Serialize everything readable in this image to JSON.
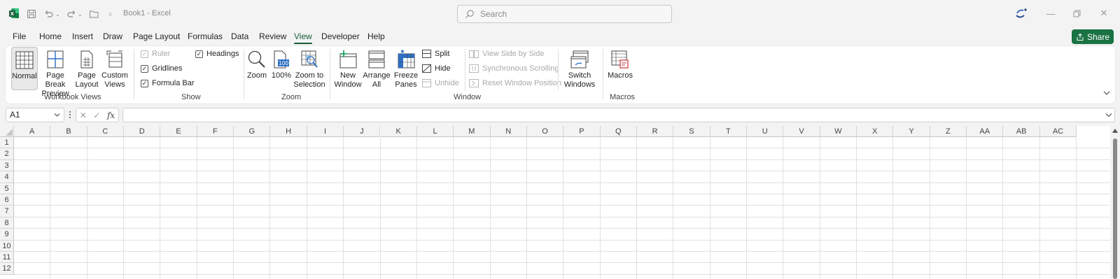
{
  "app": {
    "title": "Book1 - Excel",
    "accent": "#185c37",
    "share_color": "#1a7343"
  },
  "search": {
    "placeholder": "Search"
  },
  "menu": {
    "tabs": [
      "File",
      "Home",
      "Insert",
      "Draw",
      "Page Layout",
      "Formulas",
      "Data",
      "Review",
      "View",
      "Developer",
      "Help"
    ],
    "active": "View"
  },
  "share": {
    "label": "Share"
  },
  "ribbon": {
    "workbook_views": {
      "label": "Workbook Views",
      "normal": "Normal",
      "page_break_1": "Page Break",
      "page_break_2": "Preview",
      "page_layout_1": "Page",
      "page_layout_2": "Layout",
      "custom_1": "Custom",
      "custom_2": "Views"
    },
    "show": {
      "label": "Show",
      "ruler": "Ruler",
      "gridlines": "Gridlines",
      "formula_bar": "Formula Bar",
      "headings": "Headings"
    },
    "zoom": {
      "label": "Zoom",
      "zoom": "Zoom",
      "hundred": "100%",
      "hundred_icon": "100",
      "zoom_sel_1": "Zoom to",
      "zoom_sel_2": "Selection"
    },
    "window": {
      "label": "Window",
      "new_1": "New",
      "new_2": "Window",
      "arrange_1": "Arrange",
      "arrange_2": "All",
      "freeze_1": "Freeze",
      "freeze_2": "Panes",
      "split": "Split",
      "hide": "Hide",
      "unhide": "Unhide",
      "side_by_side": "View Side by Side",
      "sync_scroll": "Synchronous Scrolling",
      "reset_pos": "Reset Window Position",
      "switch_1": "Switch",
      "switch_2": "Windows"
    },
    "macros": {
      "label": "Macros",
      "macros": "Macros"
    }
  },
  "formula_bar": {
    "name_box": "A1",
    "fx": "fx",
    "value": ""
  },
  "grid": {
    "columns": [
      "A",
      "B",
      "C",
      "D",
      "E",
      "F",
      "G",
      "H",
      "I",
      "J",
      "K",
      "L",
      "M",
      "N",
      "O",
      "P",
      "Q",
      "R",
      "S",
      "T",
      "U",
      "V",
      "W",
      "X",
      "Y",
      "Z",
      "AA",
      "AB",
      "AC"
    ],
    "rows": [
      "1",
      "2",
      "3",
      "4",
      "5",
      "6",
      "7",
      "8",
      "9",
      "10",
      "11",
      "12"
    ]
  }
}
